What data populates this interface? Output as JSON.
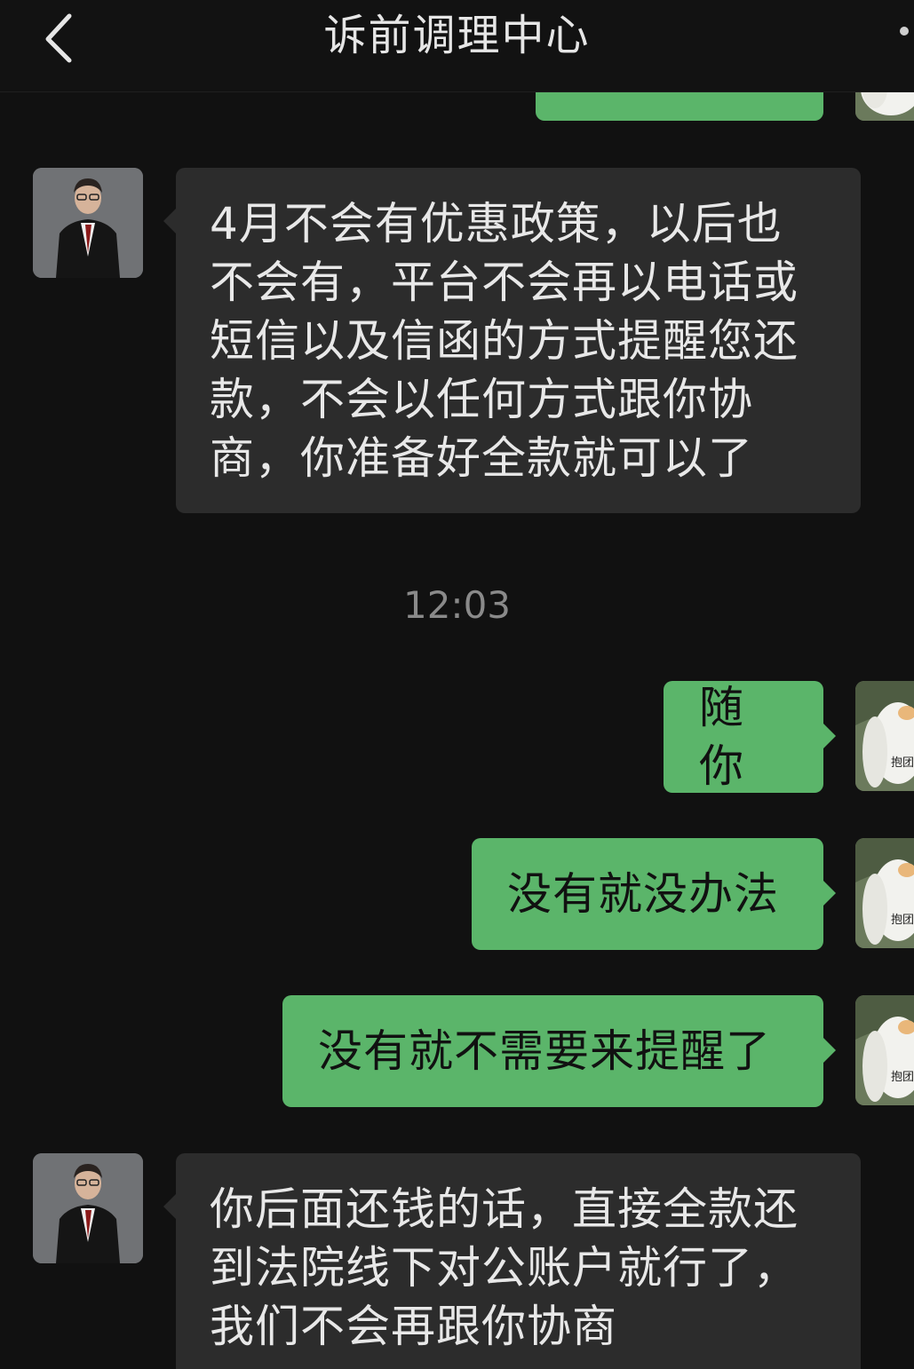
{
  "header": {
    "title": "诉前调理中心",
    "back_icon": "chevron-left-icon",
    "more_icon": "more-dots-icon"
  },
  "messages": [
    {
      "id": "lawyer-msg-1",
      "sender": "lawyer",
      "lines": [
        "4月不会有优惠政策，以后也",
        "不会有，平台不会再以电话或",
        "短信以及信函的方式提醒您还",
        "款，不会以任何方式跟你协",
        "商，你准备好全款就可以了"
      ]
    },
    {
      "id": "self-msg-1",
      "sender": "self",
      "text": "随你"
    },
    {
      "id": "self-msg-2",
      "sender": "self",
      "text": "没有就没办法"
    },
    {
      "id": "self-msg-3",
      "sender": "self",
      "text": "没有就不需要来提醒了"
    },
    {
      "id": "lawyer-msg-2",
      "sender": "lawyer",
      "lines": [
        "你后面还钱的话，直接全款还",
        "到法院线下对公账户就行了，",
        "我们不会再跟你协商"
      ]
    }
  ],
  "timestamp": "12:03",
  "self_avatar_label": "抱团",
  "colors": {
    "background": "#111111",
    "incoming_bubble": "#2c2c2c",
    "outgoing_bubble": "#5bb56a",
    "timestamp": "#8a8a8a"
  }
}
